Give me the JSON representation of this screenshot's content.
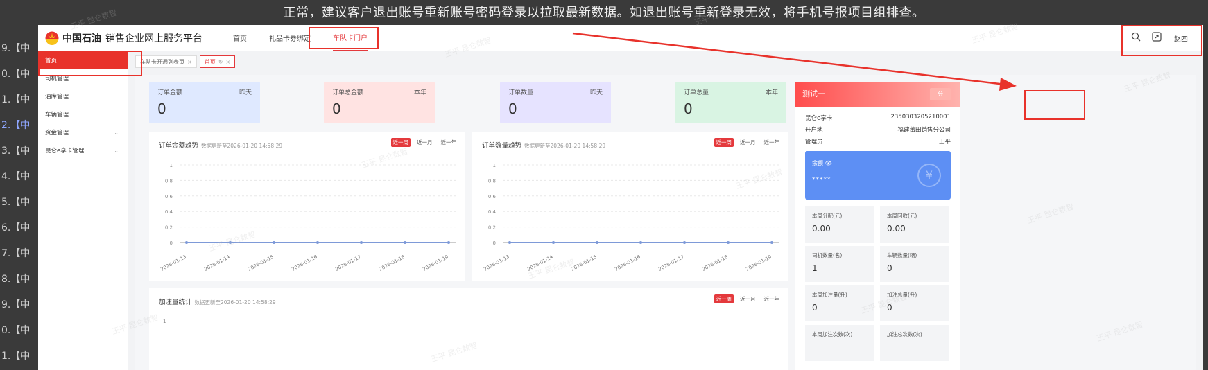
{
  "notice": "正常，建议客户退出账号重新账号密码登录以拉取最新数据。如退出账号重新登录无效，将手机号报项目组排查。",
  "left_list": [
    {
      "label": "9.【中",
      "active": false
    },
    {
      "label": "0.【中",
      "active": false
    },
    {
      "label": "1.【中",
      "active": false
    },
    {
      "label": "2.【中",
      "active": true
    },
    {
      "label": "3.【中",
      "active": false
    },
    {
      "label": "4.【中",
      "active": false
    },
    {
      "label": "5.【中",
      "active": false
    },
    {
      "label": "6.【中",
      "active": false
    },
    {
      "label": "7.【中",
      "active": false
    },
    {
      "label": "8.【中",
      "active": false
    },
    {
      "label": "9.【中",
      "active": false
    },
    {
      "label": "0.【中",
      "active": false
    },
    {
      "label": "1.【中",
      "active": false
    }
  ],
  "header": {
    "brand": "中国石油",
    "subtitle": "销售企业网上服务平台",
    "nav": [
      {
        "label": "首页",
        "active": false
      },
      {
        "label": "礼品卡券绑定",
        "active": false
      },
      {
        "label": "车队卡门户",
        "active": true
      }
    ],
    "user": "赵四"
  },
  "sidebar": [
    {
      "label": "首页",
      "active": true,
      "expandable": false
    },
    {
      "label": "司机管理",
      "active": false,
      "expandable": false
    },
    {
      "label": "油库管理",
      "active": false,
      "expandable": false
    },
    {
      "label": "车辆管理",
      "active": false,
      "expandable": false
    },
    {
      "label": "资金管理",
      "active": false,
      "expandable": true
    },
    {
      "label": "昆仑e享卡管理",
      "active": false,
      "expandable": true
    }
  ],
  "tabs": [
    {
      "label": "车队卡开通列表页",
      "active": false
    },
    {
      "label": "首页",
      "active": true
    }
  ],
  "stats": [
    {
      "label": "订单金额",
      "period": "昨天",
      "value": "0",
      "color": "#dfe9ff"
    },
    {
      "label": "订单总金额",
      "period": "本年",
      "value": "0",
      "color": "#ffe3e2"
    },
    {
      "label": "订单数量",
      "period": "昨天",
      "value": "0",
      "color": "#e6e3ff"
    },
    {
      "label": "订单总量",
      "period": "本年",
      "value": "0",
      "color": "#d9f4e3"
    }
  ],
  "charts_meta": [
    {
      "title": "订单金额趋势",
      "updated": "数据更新至2026-01-20 14:58:29",
      "tabs": [
        "近一周",
        "近一月",
        "近一年"
      ]
    },
    {
      "title": "订单数量趋势",
      "updated": "数据更新至2026-01-20 14:58:29",
      "tabs": [
        "近一周",
        "近一月",
        "近一年"
      ]
    },
    {
      "title": "加注量统计",
      "updated": "数据更新至2026-01-20 14:58:29",
      "tabs": [
        "近一周",
        "近一月",
        "近一年"
      ]
    }
  ],
  "chart_data": [
    {
      "type": "line",
      "categories": [
        "2026-01-13",
        "2026-01-14",
        "2026-01-15",
        "2026-01-16",
        "2026-01-17",
        "2026-01-18",
        "2026-01-19"
      ],
      "values": [
        0,
        0,
        0,
        0,
        0,
        0,
        0
      ],
      "yticks": [
        "0",
        "0.2",
        "0.4",
        "0.6",
        "0.8",
        "1"
      ],
      "ylim": [
        0,
        1
      ],
      "color": "#7e9ad8"
    },
    {
      "type": "line",
      "categories": [
        "2026-01-13",
        "2026-01-14",
        "2026-01-15",
        "2026-01-16",
        "2026-01-17",
        "2026-01-18",
        "2026-01-19"
      ],
      "values": [
        0,
        0,
        0,
        0,
        0,
        0,
        0
      ],
      "yticks": [
        "0",
        "0.2",
        "0.4",
        "0.6",
        "0.8",
        "1"
      ],
      "ylim": [
        0,
        1
      ],
      "color": "#7e9ad8"
    }
  ],
  "third_chart_first_tick": "1",
  "account": {
    "name": "测试一",
    "button": "分",
    "rows": [
      {
        "label": "昆仑e享卡",
        "value": "2350303205210001"
      },
      {
        "label": "开户地",
        "value": "福建莆田销售分公司"
      },
      {
        "label": "管理员",
        "value": "王平"
      }
    ],
    "balance_label": "余额 👁",
    "balance_value": "*****",
    "balance_icon": "¥",
    "metrics": [
      {
        "label": "本周分配(元)",
        "value": "0.00"
      },
      {
        "label": "本周回收(元)",
        "value": "0.00"
      },
      {
        "label": "司机数量(名)",
        "value": "1"
      },
      {
        "label": "车辆数量(辆)",
        "value": "0"
      },
      {
        "label": "本周加注量(升)",
        "value": "0"
      },
      {
        "label": "加注总量(升)",
        "value": "0"
      },
      {
        "label": "本周加注次数(次)",
        "value": ""
      },
      {
        "label": "加注总次数(次)",
        "value": ""
      }
    ]
  },
  "watermark": "王平 昆仑数智"
}
